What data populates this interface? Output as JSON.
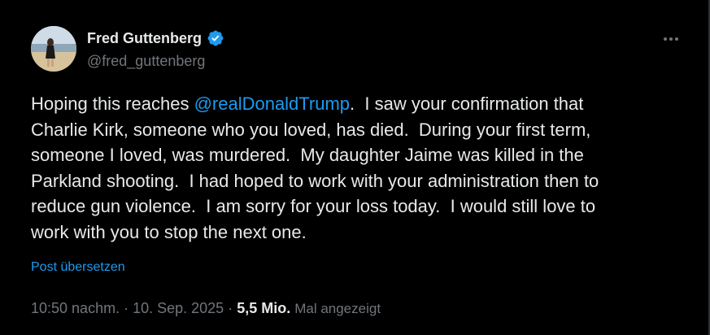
{
  "author": {
    "display_name": "Fred Guttenberg",
    "handle": "@fred_guttenberg",
    "verified": true,
    "avatar_icon": "profile-photo-beach"
  },
  "more_icon": "more-horizontal-icon",
  "tweet": {
    "segments": [
      {
        "text": "Hoping this reaches ",
        "type": "text"
      },
      {
        "text": "@realDonaldTrump",
        "type": "mention"
      },
      {
        "text": ".  I saw your confirmation that\nCharlie Kirk, someone who you loved, has died.  During your first term,\nsomeone I loved, was murdered.  My daughter Jaime was killed in the\nParkland shooting.  I had hoped to work with your administration then to\nreduce gun violence.  I am sorry for your loss today.  I would still love to\nwork with you to stop the next one.",
        "type": "text"
      }
    ]
  },
  "translate_label": "Post übersetzen",
  "meta": {
    "time": "10:50 nachm.",
    "separator": "·",
    "date": "10. Sep. 2025",
    "views_count": "5,5 Mio.",
    "views_label": "Mal angezeigt"
  },
  "colors": {
    "background": "#000000",
    "text": "#e7e9ea",
    "secondary": "#71767b",
    "link": "#1d9bf0",
    "verified": "#1d9bf0"
  }
}
